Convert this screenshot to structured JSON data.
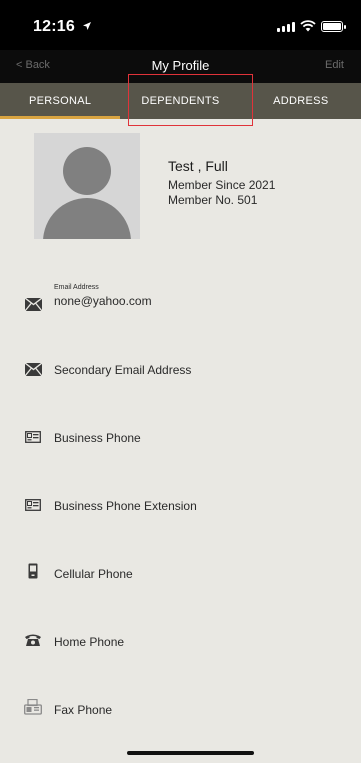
{
  "status": {
    "time": "12:16"
  },
  "nav": {
    "back_label": "< Back",
    "title": "My Profile",
    "edit_label": "Edit"
  },
  "tabs": [
    {
      "label": "PERSONAL",
      "active": true
    },
    {
      "label": "DEPENDENTS",
      "active": false
    },
    {
      "label": "ADDRESS",
      "active": false
    }
  ],
  "profile": {
    "name": "Test , Full",
    "member_since": "Member Since 2021",
    "member_no": "Member No. 501"
  },
  "fields": [
    {
      "icon": "envelope-icon",
      "label": "Email Address",
      "value": "none@yahoo.com"
    },
    {
      "icon": "envelope-icon",
      "label": "",
      "value": "Secondary Email Address"
    },
    {
      "icon": "id-card-icon",
      "label": "",
      "value": "Business Phone"
    },
    {
      "icon": "id-card-icon",
      "label": "",
      "value": "Business Phone Extension"
    },
    {
      "icon": "mobile-phone-icon",
      "label": "",
      "value": "Cellular Phone"
    },
    {
      "icon": "telephone-icon",
      "label": "",
      "value": "Home Phone"
    },
    {
      "icon": "fax-icon",
      "label": "",
      "value": "Fax Phone"
    }
  ],
  "colors": {
    "background": "#e9e8e3",
    "tab_bar": "#57554a",
    "active_tab_underline": "#d9a441",
    "highlight_box": "#e0333a"
  }
}
